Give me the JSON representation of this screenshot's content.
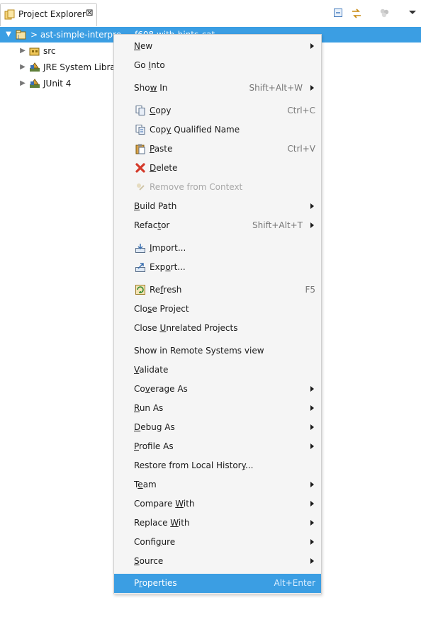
{
  "view": {
    "tab_title": "Project Explorer",
    "tab_close_symbol": "⊠",
    "toolbar": [
      {
        "name": "collapse-all-icon"
      },
      {
        "name": "link-with-editor-icon"
      },
      {
        "name": "focus-icon"
      },
      {
        "name": "view-menu-chevron-icon"
      }
    ]
  },
  "tree": {
    "root": {
      "label": "> ast-simple-interpre",
      "label_tail": "…f608 with-hints-cat…",
      "expanded": true,
      "selected": true,
      "icon": "java-project-icon"
    },
    "children": [
      {
        "label": "src",
        "icon": "source-folder-icon"
      },
      {
        "label": "JRE System Library",
        "icon": "library-icon"
      },
      {
        "label": "JUnit 4",
        "icon": "library-icon"
      }
    ]
  },
  "menu": {
    "items": [
      {
        "pre": "",
        "mn": "N",
        "post": "ew",
        "accel": "",
        "submenu": true
      },
      {
        "pre": "Go ",
        "mn": "I",
        "post": "nto",
        "accel": "",
        "submenu": false
      },
      {
        "pre": "Sho",
        "mn": "w",
        "post": " In",
        "accel": "Shift+Alt+W",
        "submenu": true
      },
      {
        "pre": "",
        "mn": "C",
        "post": "opy",
        "accel": "Ctrl+C",
        "submenu": false,
        "icon": "copy-icon"
      },
      {
        "pre": "Cop",
        "mn": "y",
        "post": " Qualified Name",
        "accel": "",
        "submenu": false,
        "icon": "copy-qualified-name-icon"
      },
      {
        "pre": "",
        "mn": "P",
        "post": "aste",
        "accel": "Ctrl+V",
        "submenu": false,
        "icon": "paste-icon"
      },
      {
        "pre": "",
        "mn": "D",
        "post": "elete",
        "accel": "",
        "submenu": false,
        "icon": "delete-icon"
      },
      {
        "pre": "Remove from Context",
        "mn": "",
        "post": "",
        "accel": "",
        "submenu": false,
        "icon": "remove-from-context-icon",
        "disabled": true
      },
      {
        "pre": "",
        "mn": "B",
        "post": "uild Path",
        "accel": "",
        "submenu": true
      },
      {
        "pre": "Refac",
        "mn": "t",
        "post": "or",
        "accel": "Shift+Alt+T",
        "submenu": true
      },
      {
        "pre": "",
        "mn": "I",
        "post": "mport...",
        "accel": "",
        "submenu": false,
        "icon": "import-icon"
      },
      {
        "pre": "Exp",
        "mn": "o",
        "post": "rt...",
        "accel": "",
        "submenu": false,
        "icon": "export-icon"
      },
      {
        "pre": "Re",
        "mn": "f",
        "post": "resh",
        "accel": "F5",
        "submenu": false,
        "icon": "refresh-icon"
      },
      {
        "pre": "Clo",
        "mn": "s",
        "post": "e Project",
        "accel": "",
        "submenu": false
      },
      {
        "pre": "Close ",
        "mn": "U",
        "post": "nrelated Projects",
        "accel": "",
        "submenu": false
      },
      {
        "pre": "Show in Remote Systems view",
        "mn": "",
        "post": "",
        "accel": "",
        "submenu": false
      },
      {
        "pre": "",
        "mn": "V",
        "post": "alidate",
        "accel": "",
        "submenu": false
      },
      {
        "pre": "Co",
        "mn": "v",
        "post": "erage As",
        "accel": "",
        "submenu": true
      },
      {
        "pre": "",
        "mn": "R",
        "post": "un As",
        "accel": "",
        "submenu": true
      },
      {
        "pre": "",
        "mn": "D",
        "post": "ebug As",
        "accel": "",
        "submenu": true
      },
      {
        "pre": "",
        "mn": "P",
        "post": "rofile As",
        "accel": "",
        "submenu": true
      },
      {
        "pre": "Restore from Local Histor",
        "mn": "y",
        "post": "...",
        "accel": "",
        "submenu": false
      },
      {
        "pre": "T",
        "mn": "e",
        "post": "am",
        "accel": "",
        "submenu": true
      },
      {
        "pre": "Compare ",
        "mn": "W",
        "post": "ith",
        "accel": "",
        "submenu": true
      },
      {
        "pre": "Replace ",
        "mn": "W",
        "post": "ith",
        "accel": "",
        "submenu": true
      },
      {
        "pre": "Confi",
        "mn": "g",
        "post": "ure",
        "accel": "",
        "submenu": true
      },
      {
        "pre": "",
        "mn": "S",
        "post": "ource",
        "accel": "",
        "submenu": true
      },
      {
        "pre": "P",
        "mn": "r",
        "post": "operties",
        "accel": "Alt+Enter",
        "submenu": false,
        "highlighted": true
      }
    ]
  },
  "colors": {
    "selection": "#3b9ee3",
    "menu_bg": "#f5f5f5",
    "disabled_text": "#a8a8a8",
    "accelerator_text": "#777777"
  }
}
